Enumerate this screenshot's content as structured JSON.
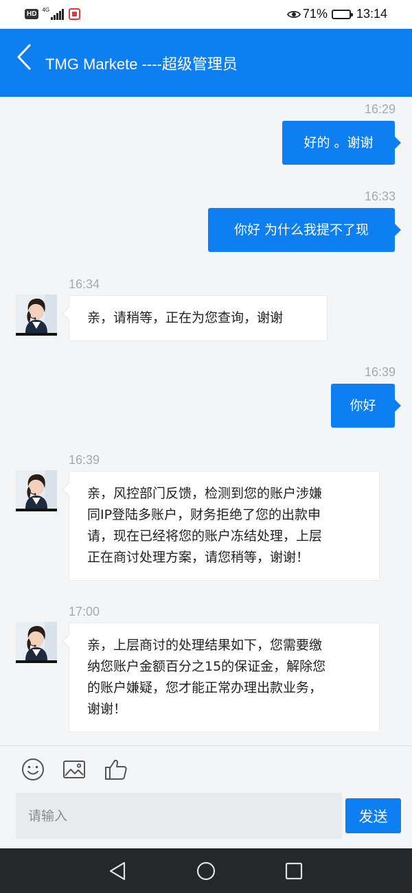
{
  "status_bar": {
    "hd": "HD",
    "network": "4G",
    "battery_percent": "71%",
    "battery_level": 0.71,
    "time": "13:14"
  },
  "header": {
    "title": "TMG Markete ----超级管理员"
  },
  "messages": [
    {
      "time": "16:29",
      "direction": "out",
      "text": "好的 。谢谢"
    },
    {
      "time": "16:33",
      "direction": "out",
      "text": "你好 为什么我提不了现"
    },
    {
      "time": "16:34",
      "direction": "in",
      "lines": [
        "亲，请稍等，正在为您查询，谢谢"
      ]
    },
    {
      "time": "16:39",
      "direction": "out",
      "text": "你好"
    },
    {
      "time": "16:39",
      "direction": "in",
      "lines": [
        "亲，风控部门反馈，检测到您的账户涉嫌",
        "同IP登陆多账户，财务拒绝了您的出款申",
        "请，现在已经将您的账户冻结处理，上层",
        "正在商讨处理方案，请您稍等，谢谢！"
      ]
    },
    {
      "time": "17:00",
      "direction": "in",
      "lines": [
        "亲，上层商讨的处理结果如下，您需要缴",
        "纳您账户金额百分之15的保证金，解除您",
        "的账户嫌疑，您才能正常办理出款业务，",
        "谢谢！"
      ]
    }
  ],
  "input": {
    "placeholder": "请输入",
    "value": "",
    "send_label": "发送"
  },
  "toolbar": {
    "icons": [
      "emoji-icon",
      "image-icon",
      "thumbs-up-icon"
    ]
  },
  "colors": {
    "accent": "#0e7ff3",
    "background": "#f4f5f7",
    "incoming_bubble": "#ffffff",
    "nav_bar": "#26272b"
  }
}
